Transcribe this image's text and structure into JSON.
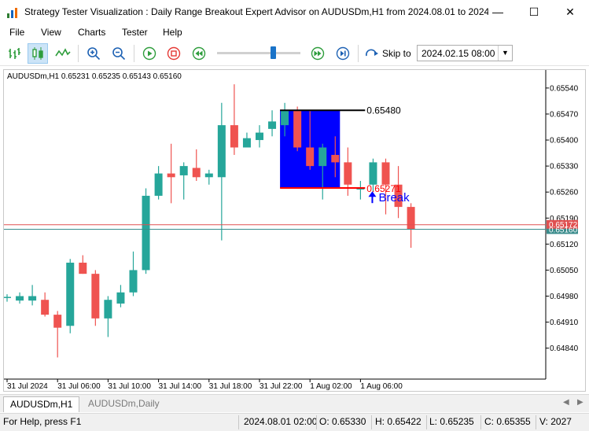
{
  "window": {
    "title": "Strategy Tester Visualization : Daily Range Breakout Expert Advisor on AUDUSDm,H1 from 2024.08.01 to 2024....",
    "minimize": "—",
    "maximize": "☐",
    "close": "✕"
  },
  "menu": [
    "File",
    "View",
    "Charts",
    "Tester",
    "Help"
  ],
  "toolbar": {
    "skip_label": "Skip to",
    "skip_date": "2024.02.15 08:00",
    "speed_fraction": 0.67
  },
  "chart": {
    "info": "AUDUSDm,H1  0.65231 0.65235 0.65143 0.65160",
    "range_high_label": "0.65480",
    "range_low_label": "0.65271",
    "break_label": "Break",
    "bid_label": "0.65160",
    "ask_label": "0.65172",
    "colors": {
      "bull": "#26a69a",
      "bear": "#ef5350",
      "range_box": "#0000ff",
      "range_high_line": "#000000",
      "range_low_line": "#ff0000",
      "break_text": "#0000ff"
    }
  },
  "chart_data": {
    "type": "candlestick",
    "y_ticks": [
      "0.65540",
      "0.65470",
      "0.65400",
      "0.65330",
      "0.65260",
      "0.65190",
      "0.65120",
      "0.65050",
      "0.64980",
      "0.64910",
      "0.64840"
    ],
    "x_ticks": [
      "31 Jul 2024",
      "31 Jul 06:00",
      "31 Jul 10:00",
      "31 Jul 14:00",
      "31 Jul 18:00",
      "31 Jul 22:00",
      "1 Aug 02:00",
      "1 Aug 06:00"
    ],
    "ylim": [
      0.6478,
      0.6558
    ],
    "range_high": 0.6548,
    "range_low": 0.65271,
    "range_start_index": 22,
    "range_end_index": 26,
    "bid": 0.6516,
    "ask": 0.65172,
    "break_index": 29,
    "candles": [
      {
        "o": 0.64975,
        "h": 0.64985,
        "l": 0.64965,
        "c": 0.64978
      },
      {
        "o": 0.64968,
        "h": 0.6499,
        "l": 0.6496,
        "c": 0.6498
      },
      {
        "o": 0.64968,
        "h": 0.6501,
        "l": 0.64955,
        "c": 0.6498
      },
      {
        "o": 0.6497,
        "h": 0.6499,
        "l": 0.64925,
        "c": 0.6493
      },
      {
        "o": 0.6493,
        "h": 0.6494,
        "l": 0.64815,
        "c": 0.64895
      },
      {
        "o": 0.649,
        "h": 0.6508,
        "l": 0.6488,
        "c": 0.6507
      },
      {
        "o": 0.6507,
        "h": 0.6509,
        "l": 0.6504,
        "c": 0.6504
      },
      {
        "o": 0.6504,
        "h": 0.6505,
        "l": 0.649,
        "c": 0.6492
      },
      {
        "o": 0.6492,
        "h": 0.6498,
        "l": 0.6487,
        "c": 0.6497
      },
      {
        "o": 0.6496,
        "h": 0.6501,
        "l": 0.6495,
        "c": 0.6499
      },
      {
        "o": 0.6499,
        "h": 0.651,
        "l": 0.6498,
        "c": 0.6505
      },
      {
        "o": 0.6505,
        "h": 0.6527,
        "l": 0.6504,
        "c": 0.6525
      },
      {
        "o": 0.6525,
        "h": 0.6533,
        "l": 0.6524,
        "c": 0.6531
      },
      {
        "o": 0.6531,
        "h": 0.6539,
        "l": 0.6523,
        "c": 0.653
      },
      {
        "o": 0.65305,
        "h": 0.6534,
        "l": 0.6524,
        "c": 0.6533
      },
      {
        "o": 0.65325,
        "h": 0.65375,
        "l": 0.6529,
        "c": 0.653
      },
      {
        "o": 0.653,
        "h": 0.6532,
        "l": 0.6528,
        "c": 0.6531
      },
      {
        "o": 0.653,
        "h": 0.655,
        "l": 0.6513,
        "c": 0.6544
      },
      {
        "o": 0.6544,
        "h": 0.6555,
        "l": 0.6536,
        "c": 0.6538
      },
      {
        "o": 0.6538,
        "h": 0.6542,
        "l": 0.6538,
        "c": 0.65405
      },
      {
        "o": 0.654,
        "h": 0.6544,
        "l": 0.6538,
        "c": 0.6542
      },
      {
        "o": 0.6543,
        "h": 0.6548,
        "l": 0.6541,
        "c": 0.6545
      },
      {
        "o": 0.6544,
        "h": 0.655,
        "l": 0.6541,
        "c": 0.6548
      },
      {
        "o": 0.6548,
        "h": 0.6549,
        "l": 0.6537,
        "c": 0.6538
      },
      {
        "o": 0.6538,
        "h": 0.6548,
        "l": 0.6532,
        "c": 0.6533
      },
      {
        "o": 0.6533,
        "h": 0.6539,
        "l": 0.6524,
        "c": 0.6538
      },
      {
        "o": 0.6536,
        "h": 0.6541,
        "l": 0.653,
        "c": 0.6534
      },
      {
        "o": 0.6534,
        "h": 0.6538,
        "l": 0.6525,
        "c": 0.6528
      },
      {
        "o": 0.6527,
        "h": 0.6529,
        "l": 0.6524,
        "c": 0.6527
      },
      {
        "o": 0.6528,
        "h": 0.6535,
        "l": 0.6526,
        "c": 0.6534
      },
      {
        "o": 0.6534,
        "h": 0.6535,
        "l": 0.652,
        "c": 0.6528
      },
      {
        "o": 0.6528,
        "h": 0.6533,
        "l": 0.6519,
        "c": 0.6522
      },
      {
        "o": 0.6522,
        "h": 0.6523,
        "l": 0.6511,
        "c": 0.6516
      }
    ]
  },
  "tabs": [
    "AUDUSDm,H1",
    "AUDUSDm,Daily"
  ],
  "status": {
    "help": "For Help, press F1",
    "datetime": "2024.08.01 02:00",
    "open": "O: 0.65330",
    "high": "H: 0.65422",
    "low": "L: 0.65235",
    "close": "C: 0.65355",
    "volume": "V: 2027"
  }
}
